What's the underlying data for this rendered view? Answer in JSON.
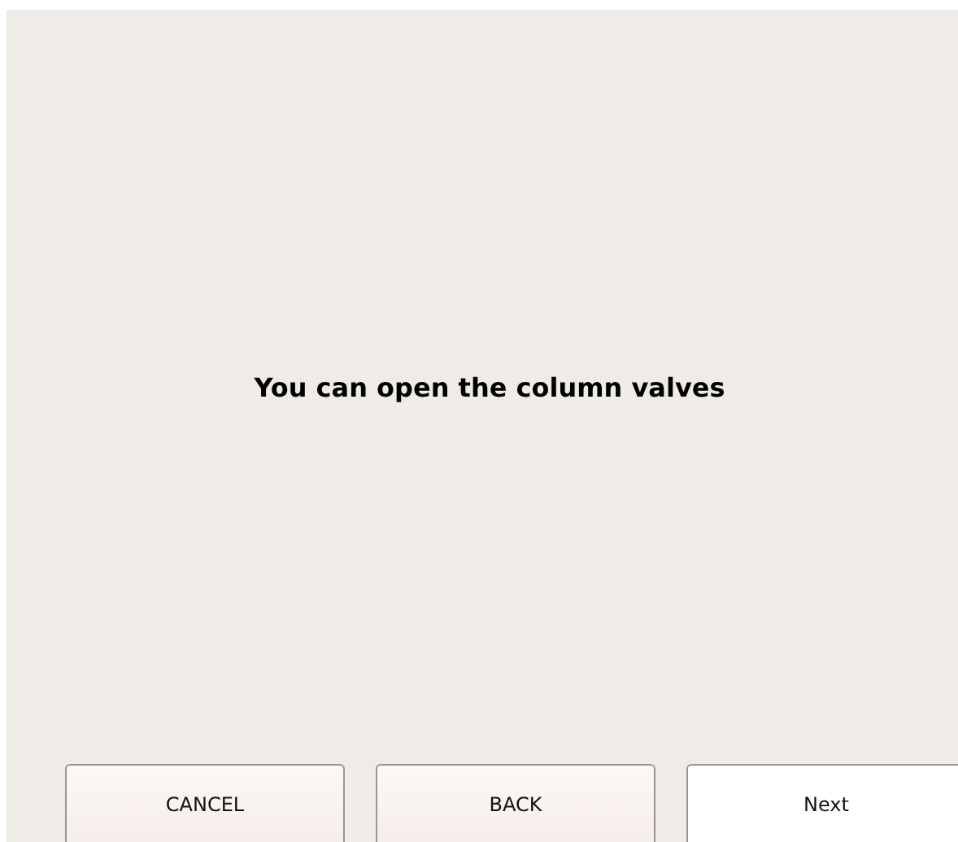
{
  "message": "You can open the column valves",
  "buttons": [
    {
      "label": "CANCEL",
      "default": false
    },
    {
      "label": "BACK",
      "default": false
    },
    {
      "label": "Next",
      "default": true
    }
  ]
}
